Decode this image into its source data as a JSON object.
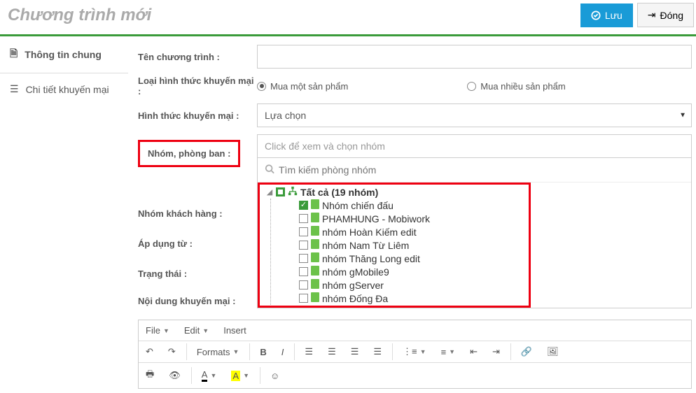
{
  "header": {
    "title": "Chương trình mới",
    "save_label": "Lưu",
    "close_label": "Đóng"
  },
  "sidebar": {
    "items": [
      {
        "label": "Thông tin chung"
      },
      {
        "label": "Chi tiết khuyến mại"
      }
    ]
  },
  "form": {
    "program_name_label": "Tên chương trình :",
    "promo_type_label": "Loại hình thức khuyến mại :",
    "promo_type_options": {
      "one": "Mua một sản phẩm",
      "many": "Mua nhiều sản phẩm"
    },
    "promo_form_label": "Hình thức khuyến mại :",
    "promo_form_value": "Lựa chọn",
    "group_label": "Nhóm, phòng ban :",
    "group_placeholder": "Click để xem và chọn nhóm",
    "group_search_placeholder": "Tìm kiếm phòng nhóm",
    "customer_group_label": "Nhóm khách hàng :",
    "apply_from_label": "Áp dụng từ :",
    "status_label": "Trạng thái :",
    "content_label": "Nội dung khuyến mại :"
  },
  "tree": {
    "root_label": "Tất cả (19 nhóm)",
    "children": [
      {
        "label": "Nhóm chiến đấu",
        "checked": true
      },
      {
        "label": "PHAMHUNG - Mobiwork",
        "checked": false
      },
      {
        "label": "nhóm Hoàn Kiếm edit",
        "checked": false
      },
      {
        "label": "nhóm Nam Từ Liêm",
        "checked": false
      },
      {
        "label": "nhóm Thăng Long edit",
        "checked": false
      },
      {
        "label": "nhóm gMobile9",
        "checked": false
      },
      {
        "label": "nhóm gServer",
        "checked": false
      },
      {
        "label": "nhóm Đống Đa",
        "checked": false
      }
    ]
  },
  "editor": {
    "menu": {
      "file": "File",
      "edit": "Edit",
      "insert": "Insert",
      "formats": "Formats"
    }
  }
}
